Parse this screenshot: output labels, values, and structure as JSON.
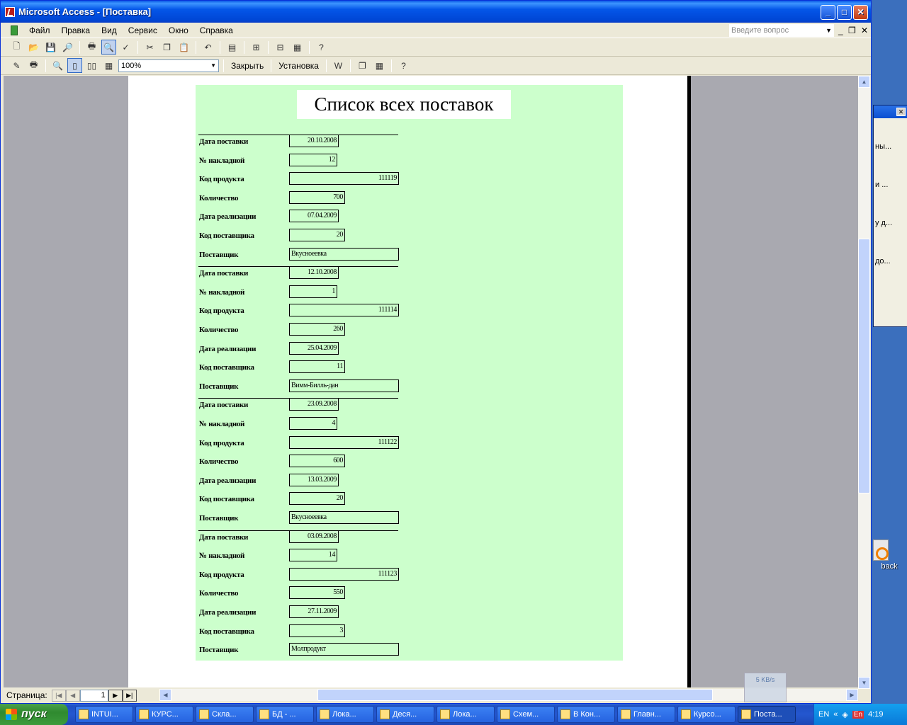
{
  "window": {
    "title": "Microsoft Access - [Поставка]",
    "min": "_",
    "max": "□",
    "close": "✕"
  },
  "menu": {
    "items": [
      "Файл",
      "Правка",
      "Вид",
      "Сервис",
      "Окно",
      "Справка"
    ],
    "ask_placeholder": "Введите вопрос",
    "mdi_min": "_",
    "mdi_restore": "❐",
    "mdi_close": "✕"
  },
  "toolbar2": {
    "zoom": "100%",
    "close_label": "Закрыть",
    "setup_label": "Установка"
  },
  "report": {
    "title": "Список всех поставок",
    "labels": [
      "Дата поставки",
      "№ накладной",
      "Код продукта",
      "Количество",
      "Дата реализации",
      "Код поставщика",
      "Поставщик"
    ],
    "records": [
      [
        "20.10.2008",
        "12",
        "111119",
        "700",
        "07.04.2009",
        "20",
        "Вкусноеевка"
      ],
      [
        "12.10.2008",
        "1",
        "111114",
        "260",
        "25.04.2009",
        "11",
        "Вимм-Билль-дан"
      ],
      [
        "23.09.2008",
        "4",
        "111122",
        "600",
        "13.03.2009",
        "20",
        "Вкусноеевка"
      ],
      [
        "03.09.2008",
        "14",
        "111123",
        "550",
        "27.11.2009",
        "3",
        "Молпродукт"
      ]
    ]
  },
  "nav": {
    "page_label": "Страница:",
    "page_number": "1"
  },
  "network": {
    "speed": "5 KB/s"
  },
  "desktop": {
    "bg_items": [
      "ны...",
      "и ...",
      "у д...",
      "до..."
    ],
    "icon_label": "back"
  },
  "taskbar": {
    "start": "пуск",
    "tasks": [
      "INTUI...",
      "КУРС...",
      "Скла...",
      "БД - ...",
      "Лока...",
      "Деся...",
      "Лока...",
      "Схем...",
      "В Кон...",
      "Главн...",
      "Курсо...",
      "Поста..."
    ],
    "lang": "EN",
    "lang2": "En",
    "clock": "4:19"
  },
  "colors": {
    "report_bg": "#ccffcc",
    "titlebar": "#0a58e4",
    "taskbar": "#245edb"
  }
}
